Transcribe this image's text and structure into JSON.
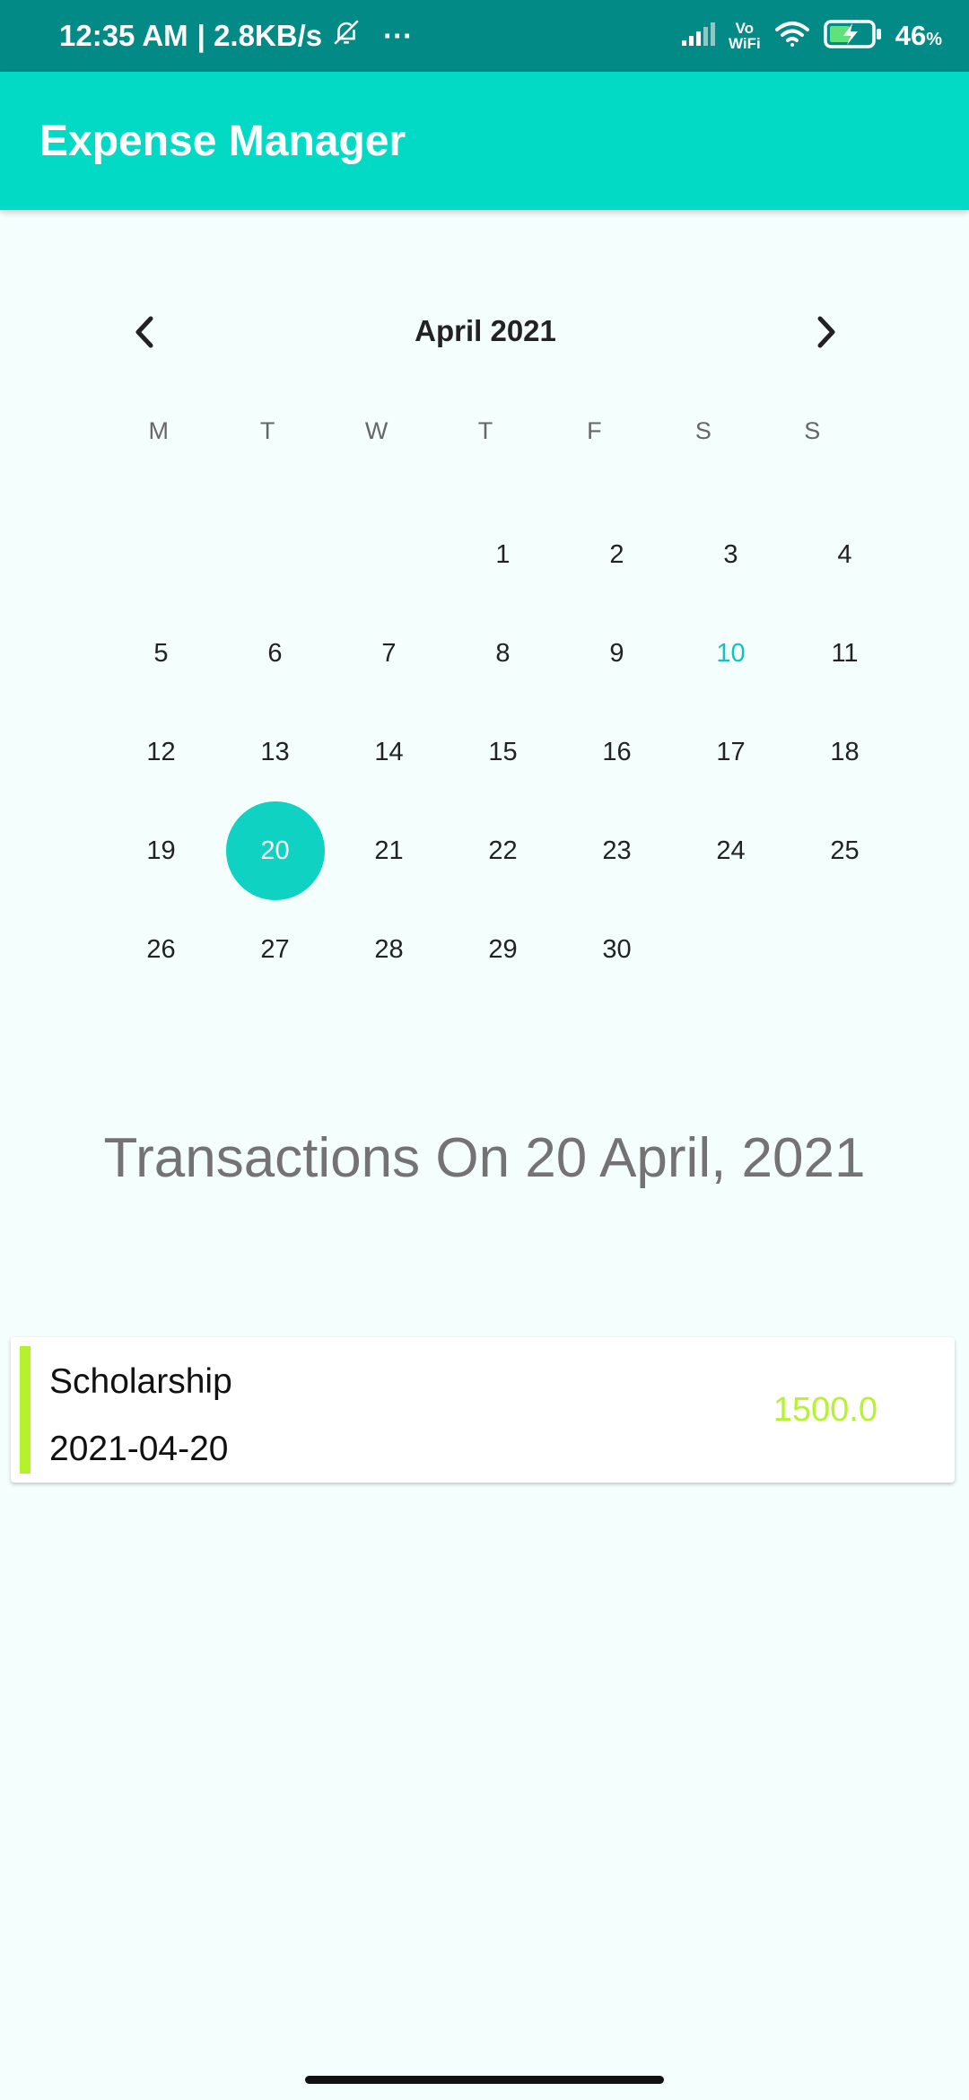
{
  "status_bar": {
    "time": "12:35 AM",
    "net_speed": "| 2.8KB/s",
    "more": "···",
    "vowifi_top": "Vo",
    "vowifi_bottom": "WiFi",
    "battery": "46",
    "battery_unit": "%",
    "icons": [
      "bell-off-icon",
      "signal-icon",
      "wifi-icon",
      "battery-charging-icon"
    ]
  },
  "app_bar": {
    "title": "Expense Manager"
  },
  "calendar": {
    "month_label": "April 2021",
    "weekdays": [
      "M",
      "T",
      "W",
      "T",
      "F",
      "S",
      "S"
    ],
    "days": [
      "",
      "",
      "",
      "1",
      "2",
      "3",
      "4",
      "5",
      "6",
      "7",
      "8",
      "9",
      "10",
      "11",
      "12",
      "13",
      "14",
      "15",
      "16",
      "17",
      "18",
      "19",
      "20",
      "21",
      "22",
      "23",
      "24",
      "25",
      "26",
      "27",
      "28",
      "29",
      "30"
    ],
    "today": "10",
    "selected": "20",
    "accent_color": "#10d2c2"
  },
  "transactions": {
    "heading": "Transactions On 20 April, 2021",
    "items": [
      {
        "title": "Scholarship",
        "date": "2021-04-20",
        "amount": "1500.0",
        "accent_color": "#b4f22c"
      }
    ]
  }
}
